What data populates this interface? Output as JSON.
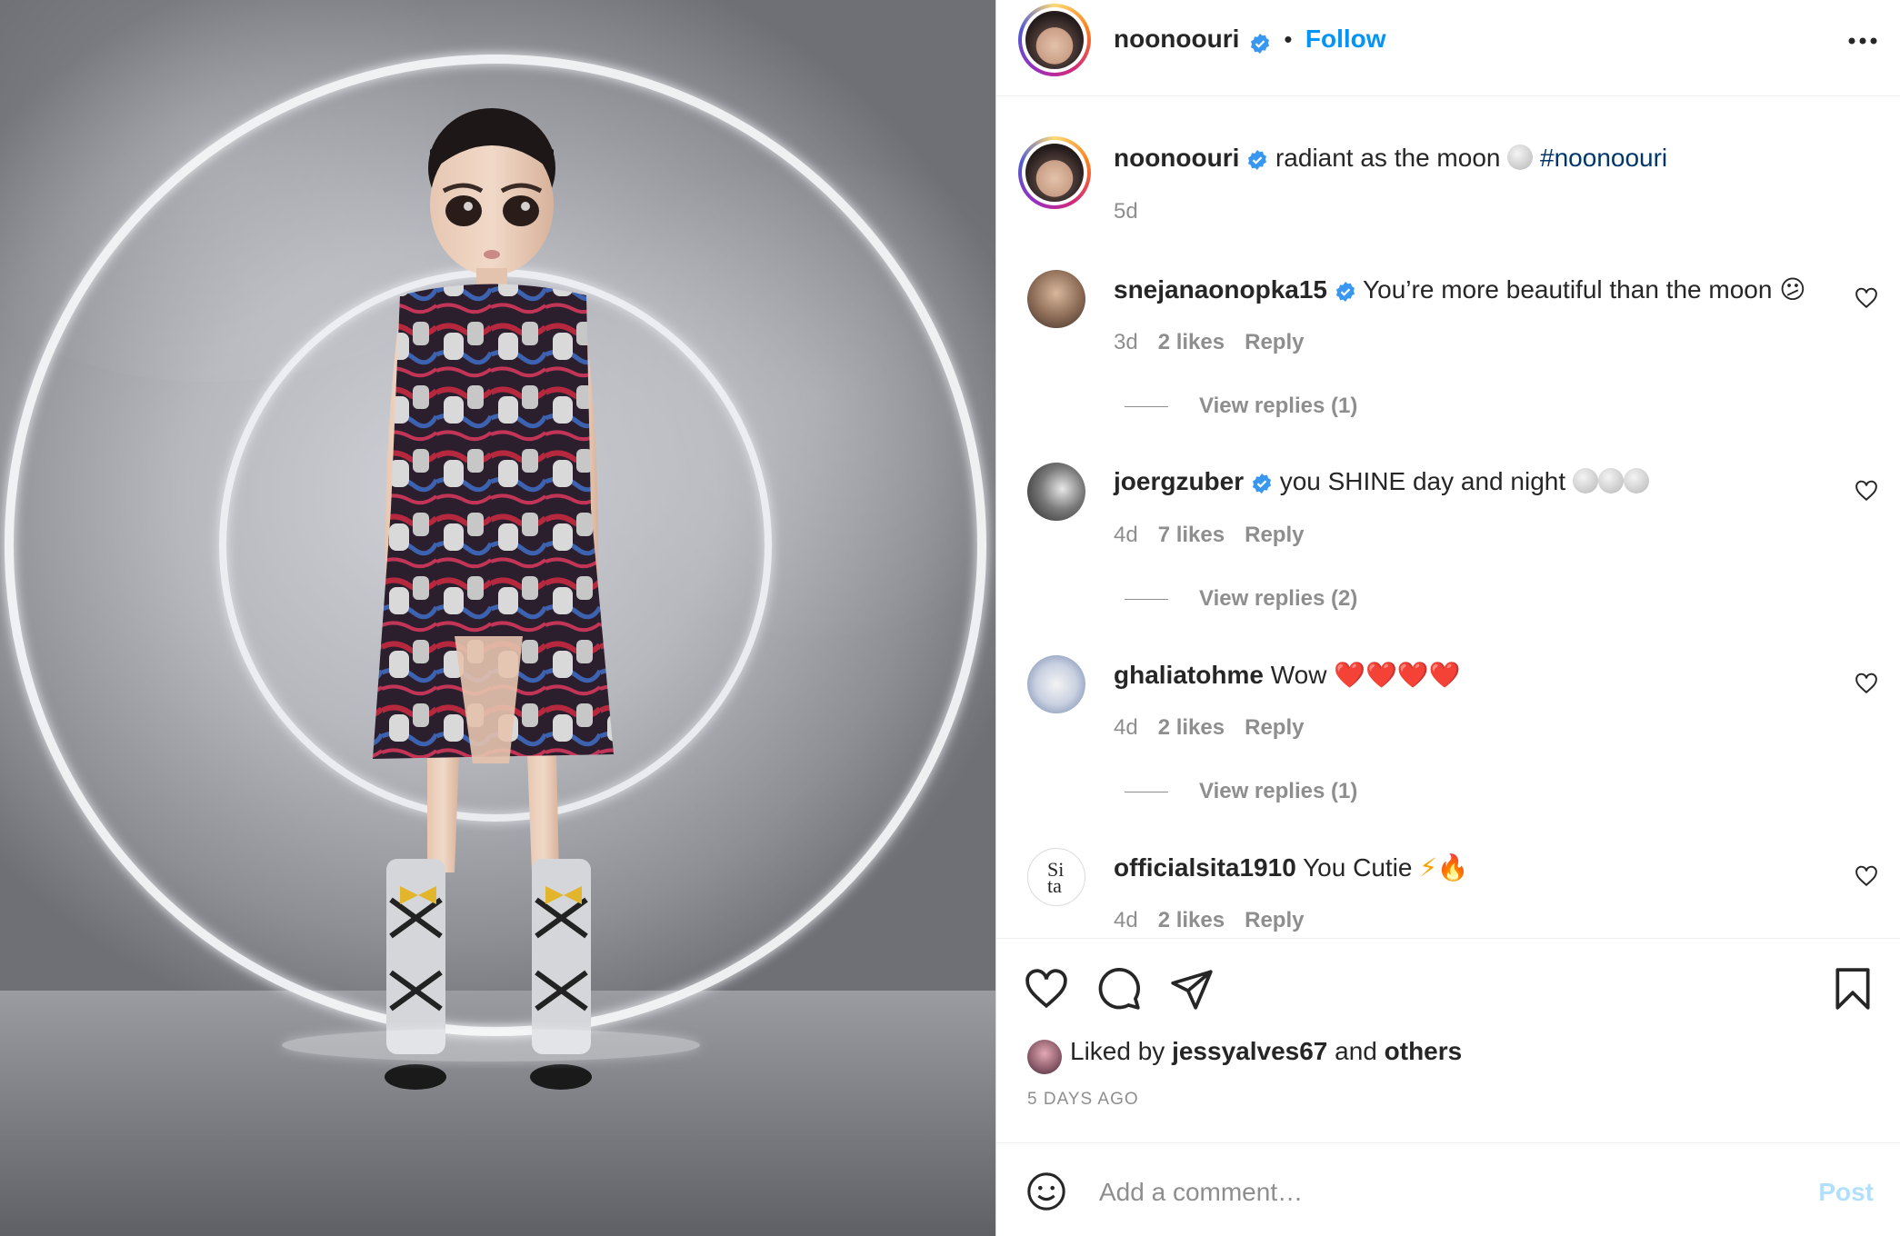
{
  "post": {
    "author": "noonoouri",
    "follow_label": "Follow",
    "separator": "•",
    "caption_text": "radiant as the moon",
    "caption_hashtag": "#noonoouri",
    "caption_age": "5d"
  },
  "comments": [
    {
      "username": "snejanaonopka15",
      "verified": true,
      "text": "You’re more beautiful than the moon",
      "emoji": "😕",
      "age": "3d",
      "likes": "2 likes",
      "reply": "Reply",
      "view_replies": "View replies (1)"
    },
    {
      "username": "joergzuber",
      "verified": true,
      "text": "you SHINE day and night",
      "emoji": "moon x3",
      "age": "4d",
      "likes": "7 likes",
      "reply": "Reply",
      "view_replies": "View replies (2)"
    },
    {
      "username": "ghaliatohme",
      "verified": false,
      "text": "Wow",
      "emoji": "❤️❤️❤️❤️",
      "age": "4d",
      "likes": "2 likes",
      "reply": "Reply",
      "view_replies": "View replies (1)"
    },
    {
      "username": "officialsita1910",
      "verified": false,
      "text": "You Cutie",
      "emoji": "⚡🔥",
      "age": "4d",
      "likes": "2 likes",
      "reply": "Reply"
    }
  ],
  "actions": {
    "liked_prefix": "Liked by",
    "liked_user": "jessyalves67",
    "liked_and": "and",
    "liked_others": "others",
    "posted_ago": "5 DAYS AGO"
  },
  "add_comment": {
    "placeholder": "Add a comment…",
    "post_label": "Post"
  },
  "icons": [
    "more-options-icon",
    "verified-badge-icon",
    "heart-icon",
    "comment-icon",
    "share-icon",
    "bookmark-icon",
    "emoji-icon"
  ],
  "colors": {
    "link": "#0095f6",
    "hashtag": "#00376b",
    "verified": "#3897f0",
    "muted": "#8e8e8e",
    "post_disabled": "#b2dffc"
  }
}
